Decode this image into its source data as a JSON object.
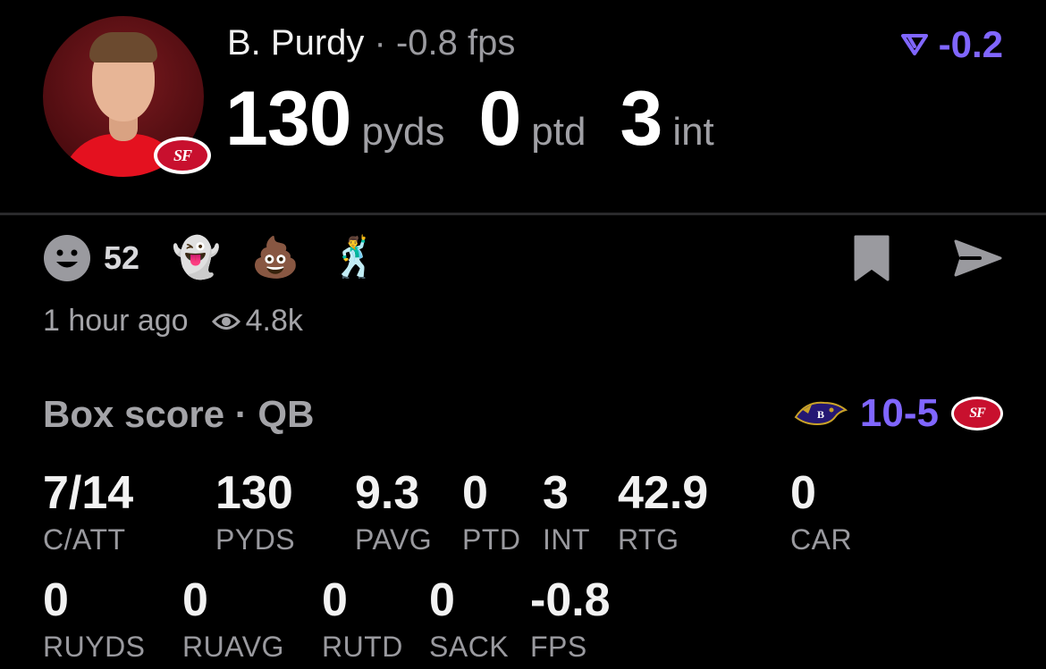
{
  "player": {
    "name": "B. Purdy",
    "separator": " · ",
    "fps_text": "-0.8 fps",
    "team_abbr": "SF"
  },
  "headline_stats": [
    {
      "value": "130",
      "unit": "pyds"
    },
    {
      "value": "0",
      "unit": "ptd"
    },
    {
      "value": "3",
      "unit": "int"
    }
  ],
  "delta": {
    "value": "-0.2",
    "color": "#8066ff",
    "icon": "down-delta-icon"
  },
  "reactions": {
    "smile_count": "52",
    "emojis": [
      "👻",
      "💩",
      "🕺"
    ]
  },
  "meta": {
    "time": "1 hour ago",
    "views": "4.8k"
  },
  "box_score": {
    "title": "Box score · QB",
    "away_abbr": "BAL",
    "away_score": "10",
    "dash": "-",
    "home_score": "5",
    "home_abbr": "SF",
    "row1": [
      {
        "value": "7/14",
        "label": "C/ATT"
      },
      {
        "value": "130",
        "label": "PYDS"
      },
      {
        "value": "9.3",
        "label": "PAVG"
      },
      {
        "value": "0",
        "label": "PTD"
      },
      {
        "value": "3",
        "label": "INT"
      },
      {
        "value": "42.9",
        "label": "RTG"
      },
      {
        "value": "0",
        "label": "CAR"
      }
    ],
    "row2": [
      {
        "value": "0",
        "label": "RUYDS"
      },
      {
        "value": "0",
        "label": "RUAVG"
      },
      {
        "value": "0",
        "label": "RUTD"
      },
      {
        "value": "0",
        "label": "SACK"
      },
      {
        "value": "-0.8",
        "label": "FPS"
      }
    ]
  },
  "colors": {
    "accent": "#8066ff",
    "team_red": "#c8102e",
    "muted": "#9a9a9f"
  }
}
